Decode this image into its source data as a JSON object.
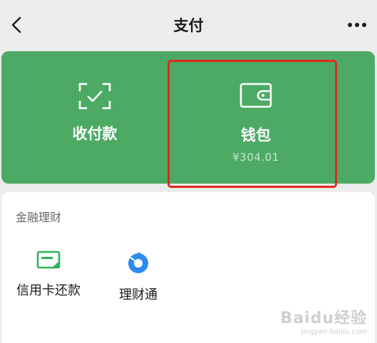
{
  "header": {
    "title": "支付",
    "back_icon": "chevron-left-icon",
    "more_icon": "more-dots-icon"
  },
  "top_card": {
    "color": "#4caa64",
    "receive_pay": {
      "label": "收付款",
      "icon": "scan-check-icon"
    },
    "wallet": {
      "label": "钱包",
      "balance": "¥304.01",
      "icon": "wallet-icon"
    },
    "highlight_color": "#e0281f"
  },
  "finance": {
    "title": "金融理财",
    "items": [
      {
        "label": "信用卡还款",
        "icon": "credit-card-repay-icon",
        "color": "#2fb35a"
      },
      {
        "label": "理财通",
        "icon": "licaitong-icon",
        "color": "#2c8cf0"
      }
    ]
  },
  "watermark": {
    "logo": "Baidu经验",
    "url": "jingyan.baidu.com"
  }
}
